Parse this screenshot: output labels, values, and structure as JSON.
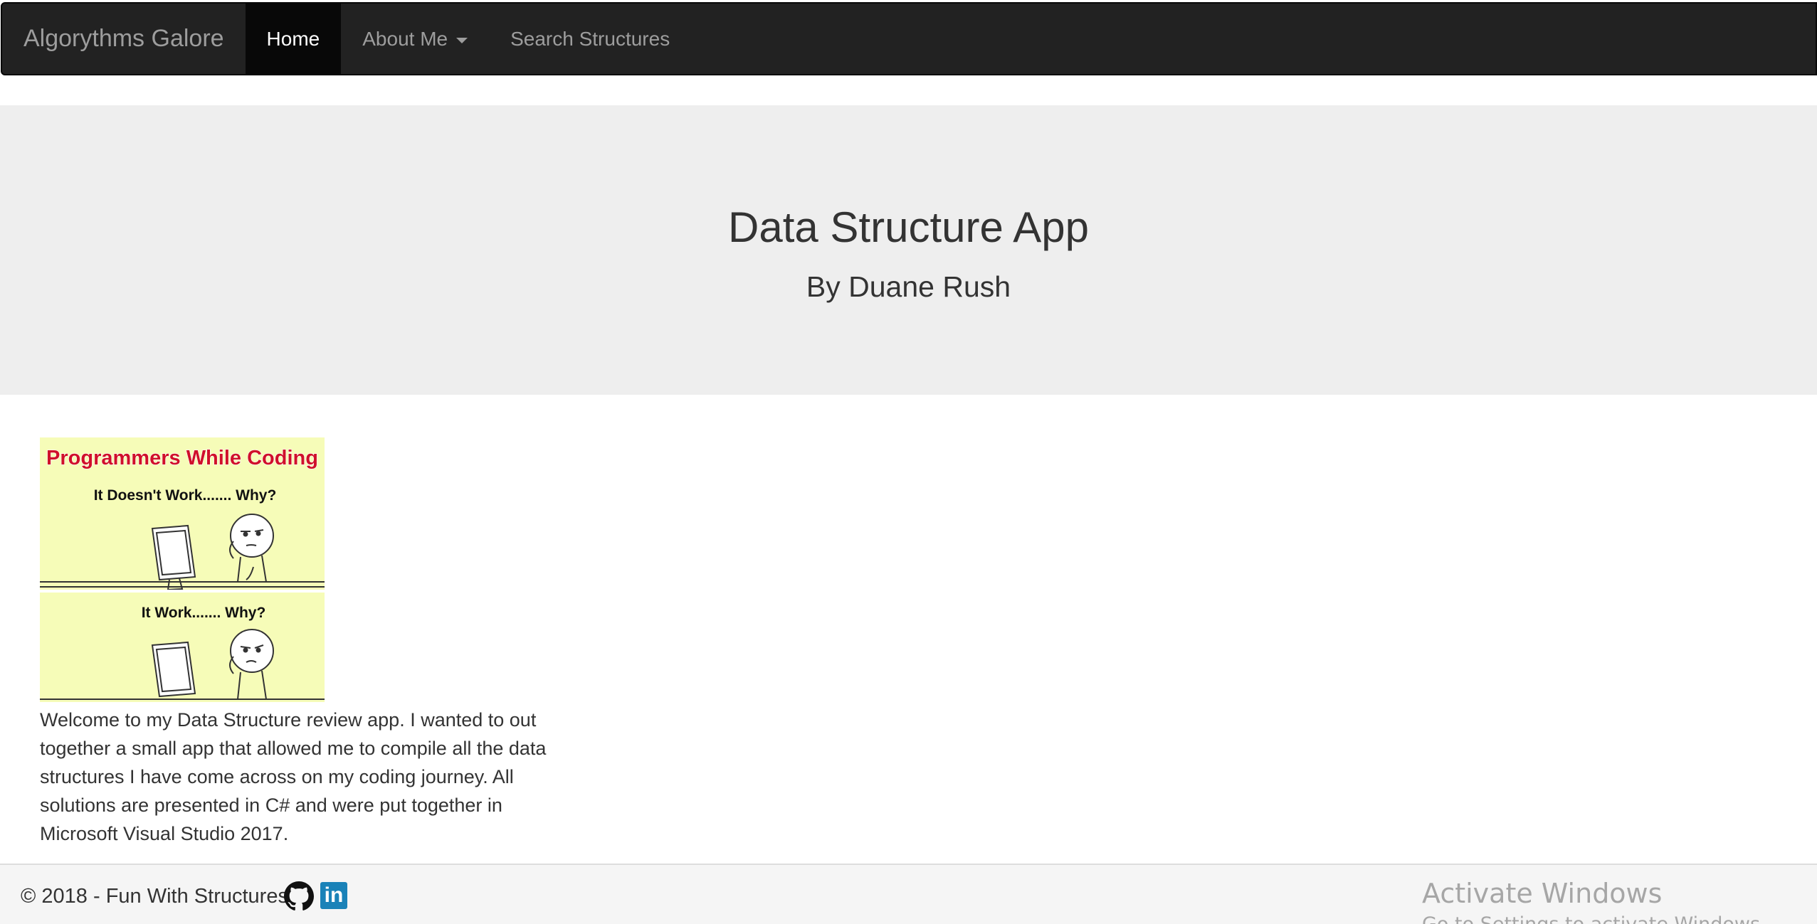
{
  "navbar": {
    "brand": "Algorythms Galore",
    "items": [
      {
        "label": "Home",
        "active": true
      },
      {
        "label": "About Me",
        "dropdown": true
      },
      {
        "label": "Search Structures"
      }
    ]
  },
  "jumbotron": {
    "title": "Data Structure App",
    "subtitle": "By Duane Rush"
  },
  "comic": {
    "heading": "Programmers While Coding",
    "panel1_caption": "It Doesn't Work....... Why?",
    "panel2_caption": "It Work....... Why?"
  },
  "welcome": {
    "text": "Welcome to my Data Structure review app. I wanted to out together a small app that allowed me to compile all the data structures I have come across on my coding journey. All solutions are presented in C# and were put together in Microsoft Visual Studio 2017."
  },
  "footer": {
    "copyright": "© 2018 - Fun With Structures",
    "icons": [
      "github-icon",
      "linkedin-icon"
    ],
    "linkedin_glyph": "in"
  },
  "watermark": {
    "title": "Activate Windows",
    "subtitle": "Go to Settings to activate Windows."
  },
  "colors": {
    "navbar_bg": "#222222",
    "navbar_active_bg": "#080808",
    "navbar_text": "#9d9d9d",
    "jumbotron_bg": "#eeeeee",
    "footer_bg": "#f5f5f5",
    "linkedin_blue": "#1a82b8",
    "comic_bg": "#f6fcb8",
    "comic_heading": "#d0102a"
  }
}
